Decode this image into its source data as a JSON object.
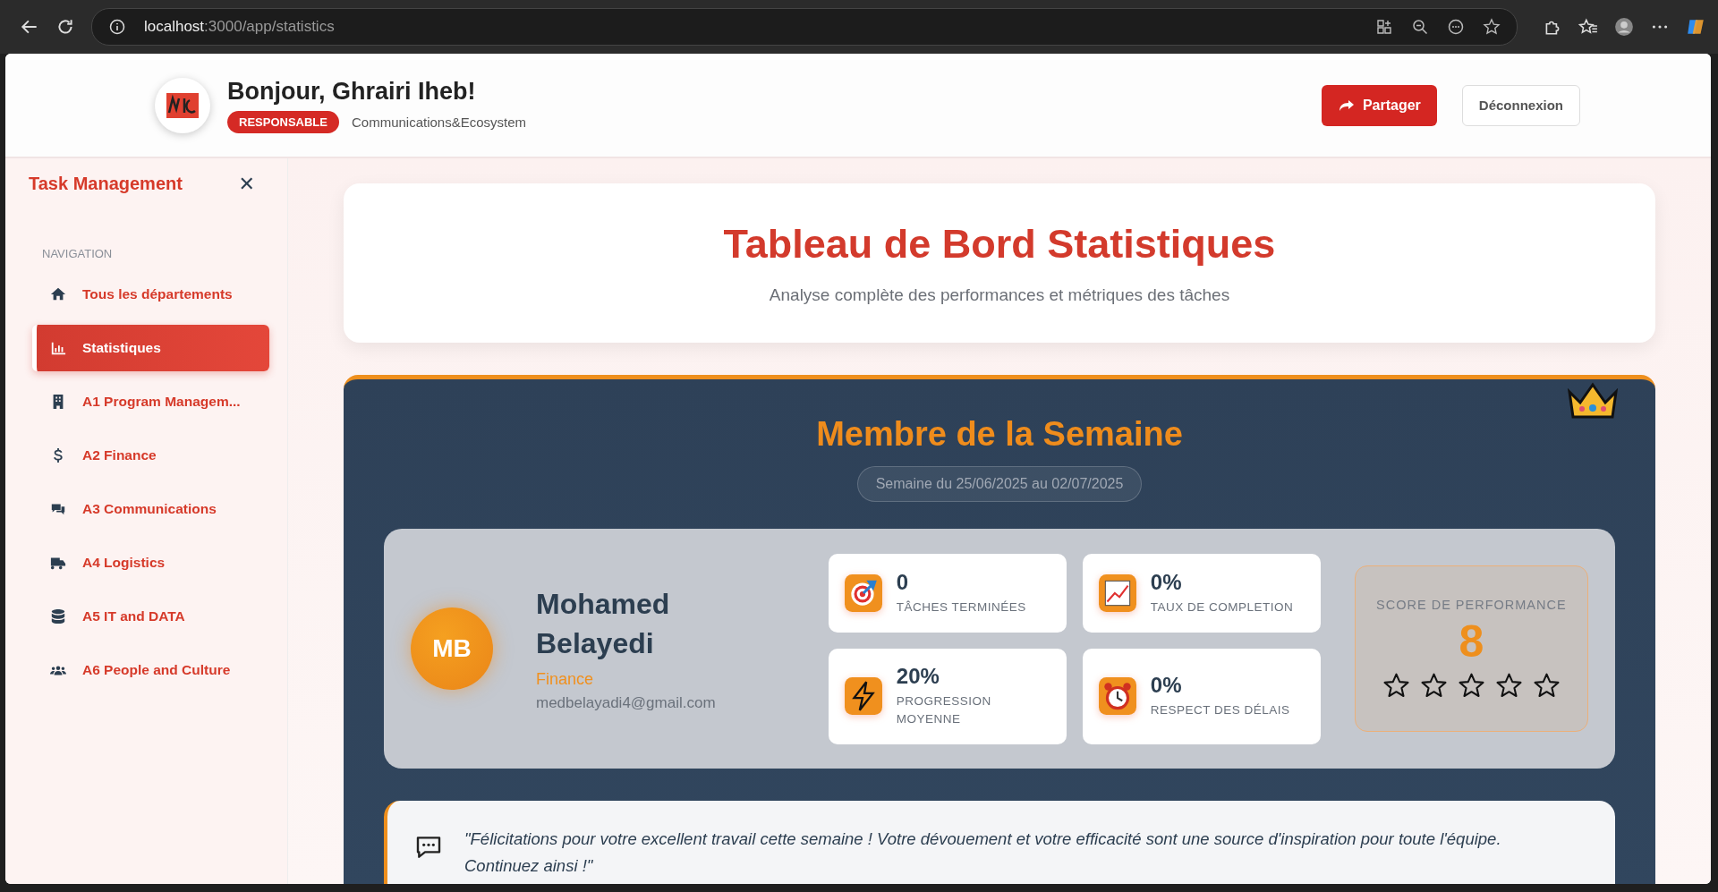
{
  "browser": {
    "url_host": "localhost",
    "url_path": ":3000/app/statistics"
  },
  "header": {
    "greeting": "Bonjour, Ghrairi Iheb!",
    "role": "RESPONSABLE",
    "department": "Communications&Ecosystem",
    "buttons": [
      {
        "kind": "primary",
        "label": "Partager"
      },
      {
        "kind": "secondary",
        "label": "Déconnexion"
      }
    ]
  },
  "sidebar": {
    "title": "Task Management",
    "close": "✕",
    "section": "NAVIGATION",
    "items": [
      {
        "kind": "home",
        "label": "Tous les départements",
        "selected": false
      },
      {
        "kind": "chart",
        "label": "Statistiques",
        "selected": true
      },
      {
        "kind": "building",
        "label": "A1 Program Managem...",
        "selected": false
      },
      {
        "kind": "dollar",
        "label": "A2 Finance",
        "selected": false
      },
      {
        "kind": "chat",
        "label": "A3 Communications",
        "selected": false
      },
      {
        "kind": "truck",
        "label": "A4 Logistics",
        "selected": false
      },
      {
        "kind": "database",
        "label": "A5 IT and DATA",
        "selected": false
      },
      {
        "kind": "users",
        "label": "A6 People and Culture",
        "selected": false
      }
    ]
  },
  "dashboard": {
    "title": "Tableau de Bord Statistiques",
    "subtitle": "Analyse complète des performances et métriques des tâches"
  },
  "member_of_week": {
    "title": "Membre de la Semaine",
    "period": "Semaine du 25/06/2025 au 02/07/2025",
    "member": {
      "initials": "MB",
      "name": "Mohamed Belayedi",
      "department": "Finance",
      "email": "medbelayadi4@gmail.com"
    },
    "stats": [
      {
        "kind": "target",
        "value": "0",
        "label": "TÂCHES TERMINÉES"
      },
      {
        "kind": "chart",
        "value": "0%",
        "label": "TAUX DE COMPLETION"
      },
      {
        "kind": "bolt",
        "value": "20%",
        "label": "PROGRESSION MOYENNE"
      },
      {
        "kind": "alarm",
        "value": "0%",
        "label": "RESPECT DES DÉLAIS"
      }
    ],
    "score": {
      "label": "SCORE DE PERFORMANCE",
      "value": "8",
      "stars": 0
    },
    "quote": "\"Félicitations pour votre excellent travail cette semaine ! Votre dévouement et votre efficacité sont une source d'inspiration pour toute l'équipe. Continuez ainsi !\""
  }
}
